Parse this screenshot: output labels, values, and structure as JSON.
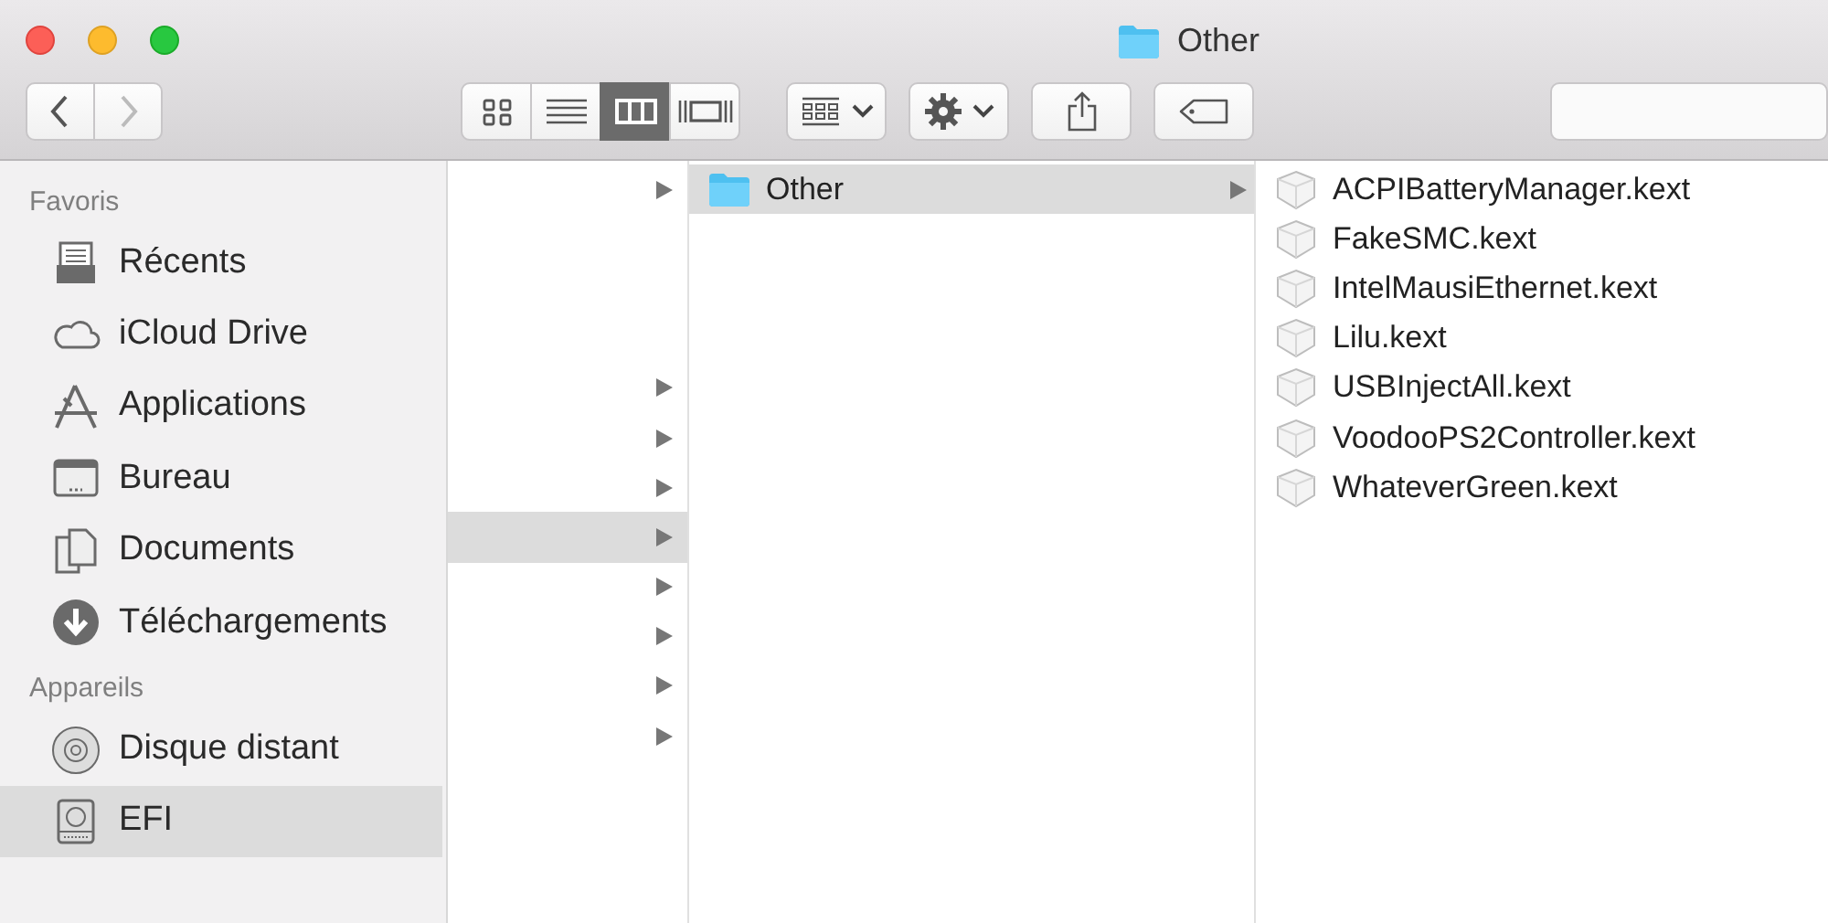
{
  "window": {
    "title": "Other"
  },
  "toolbar": {
    "view_modes": [
      {
        "kind": "icons",
        "selected": false
      },
      {
        "kind": "list",
        "selected": false
      },
      {
        "kind": "columns",
        "selected": true
      },
      {
        "kind": "gallery",
        "selected": false
      }
    ]
  },
  "sidebar": {
    "sections": [
      {
        "title": "Favoris",
        "items": [
          {
            "label": "Récents",
            "kind": "recents",
            "selected": false
          },
          {
            "label": "iCloud Drive",
            "kind": "cloud",
            "selected": false
          },
          {
            "label": "Applications",
            "kind": "apps",
            "selected": false
          },
          {
            "label": "Bureau",
            "kind": "desktop",
            "selected": false
          },
          {
            "label": "Documents",
            "kind": "documents",
            "selected": false
          },
          {
            "label": "Téléchargements",
            "kind": "downloads",
            "selected": false
          }
        ]
      },
      {
        "title": "Appareils",
        "items": [
          {
            "label": "Disque distant",
            "kind": "disc",
            "selected": false
          },
          {
            "label": "EFI",
            "kind": "drive",
            "selected": true
          }
        ]
      }
    ]
  },
  "columns": [
    {
      "rows": [
        {
          "expandable": true,
          "selected": false
        },
        {
          "kind": "blank"
        },
        {
          "kind": "blank"
        },
        {
          "kind": "blank"
        },
        {
          "expandable": true,
          "selected": false
        },
        {
          "expandable": true,
          "selected": false
        },
        {
          "expandable": true,
          "selected": false
        },
        {
          "expandable": true,
          "selected": true
        },
        {
          "expandable": true,
          "selected": false
        },
        {
          "expandable": true,
          "selected": false
        },
        {
          "expandable": true,
          "selected": false
        },
        {
          "expandable": true,
          "selected": false
        }
      ]
    },
    {
      "rows": [
        {
          "name": "Other",
          "kind": "folder",
          "expandable": true,
          "selected": true
        }
      ]
    },
    {
      "rows": [
        {
          "name": "ACPIBatteryManager.kext",
          "kind": "kext",
          "expandable": false,
          "selected": false
        },
        {
          "name": "FakeSMC.kext",
          "kind": "kext",
          "expandable": false,
          "selected": false
        },
        {
          "name": "IntelMausiEthernet.kext",
          "kind": "kext",
          "expandable": false,
          "selected": false
        },
        {
          "name": "Lilu.kext",
          "kind": "kext",
          "expandable": false,
          "selected": false
        },
        {
          "name": "USBInjectAll.kext",
          "kind": "kext",
          "expandable": false,
          "selected": false
        },
        {
          "name": "VoodooPS2Controller.kext",
          "kind": "kext",
          "expandable": false,
          "selected": false
        },
        {
          "name": "WhateverGreen.kext",
          "kind": "kext",
          "expandable": false,
          "selected": false
        }
      ]
    }
  ]
}
